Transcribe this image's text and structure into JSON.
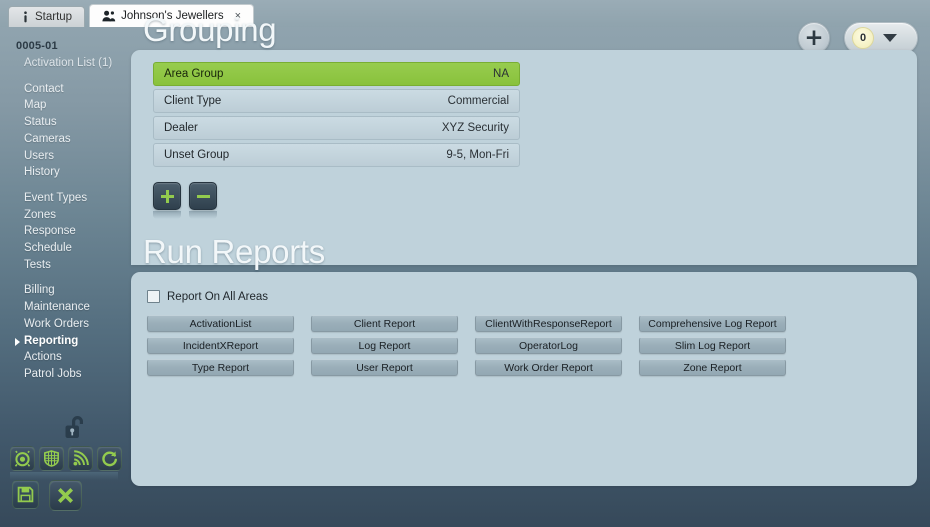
{
  "window": {
    "tabs": [
      {
        "label": "Startup",
        "icon": "info-icon",
        "active": false,
        "closable": false
      },
      {
        "label": "Johnson's Jewellers",
        "icon": "contacts-icon",
        "active": true,
        "closable": true,
        "close_label": "×"
      }
    ]
  },
  "topbar": {
    "add_label": "✚",
    "counter_value": "0",
    "dropdown_icon": "chevron-down-icon"
  },
  "sidebar": {
    "account_number": "0005-01",
    "groups": [
      {
        "items": [
          {
            "label": "Activation List (1)",
            "sub": true,
            "selected": false
          }
        ]
      },
      {
        "items": [
          {
            "label": "Contact",
            "selected": false
          },
          {
            "label": "Map",
            "selected": false
          },
          {
            "label": "Status",
            "selected": false
          },
          {
            "label": "Cameras",
            "selected": false
          },
          {
            "label": "Users",
            "selected": false
          },
          {
            "label": "History",
            "selected": false
          }
        ]
      },
      {
        "items": [
          {
            "label": "Event Types",
            "selected": false
          },
          {
            "label": "Zones",
            "selected": false
          },
          {
            "label": "Response",
            "selected": false
          },
          {
            "label": "Schedule",
            "selected": false
          },
          {
            "label": "Tests",
            "selected": false
          }
        ]
      },
      {
        "items": [
          {
            "label": "Billing",
            "selected": false
          },
          {
            "label": "Maintenance",
            "selected": false
          },
          {
            "label": "Work Orders",
            "selected": false
          },
          {
            "label": "Reporting",
            "selected": true
          },
          {
            "label": "Actions",
            "selected": false
          },
          {
            "label": "Patrol Jobs",
            "selected": false
          }
        ]
      }
    ]
  },
  "grouping": {
    "title": "Grouping",
    "rows": [
      {
        "name": "Area Group",
        "value": "NA",
        "highlight": true
      },
      {
        "name": "Client Type",
        "value": "Commercial",
        "highlight": false
      },
      {
        "name": "Dealer",
        "value": "XYZ Security",
        "highlight": false
      },
      {
        "name": "Unset Group",
        "value": "9-5, Mon-Fri",
        "highlight": false
      }
    ],
    "add_button": "add-group-button",
    "remove_button": "remove-group-button"
  },
  "reports": {
    "title": "Run Reports",
    "checkbox_label": "Report On All Areas",
    "checkbox_checked": false,
    "buttons": [
      "ActivationList",
      "Client Report",
      "ClientWithResponseReport",
      "Comprehensive Log Report",
      "IncidentXReport",
      "Log Report",
      "OperatorLog",
      "Slim Log Report",
      "Type Report",
      "User Report",
      "Work Order Report",
      "Zone Report"
    ]
  },
  "toolbar": {
    "lock_icon": "unlock-icon",
    "icons": [
      {
        "name": "alarm-clock-icon"
      },
      {
        "name": "grid-shield-icon"
      },
      {
        "name": "signal-icon"
      },
      {
        "name": "refresh-icon"
      }
    ],
    "actions": [
      {
        "name": "save-icon"
      },
      {
        "name": "cancel-icon"
      }
    ]
  },
  "colors": {
    "accent_green": "#8cc63f",
    "panel": "#bfd2db",
    "background_top": "#8fa3ad",
    "background_bottom": "#36495a",
    "button": "#9aaeb9"
  }
}
